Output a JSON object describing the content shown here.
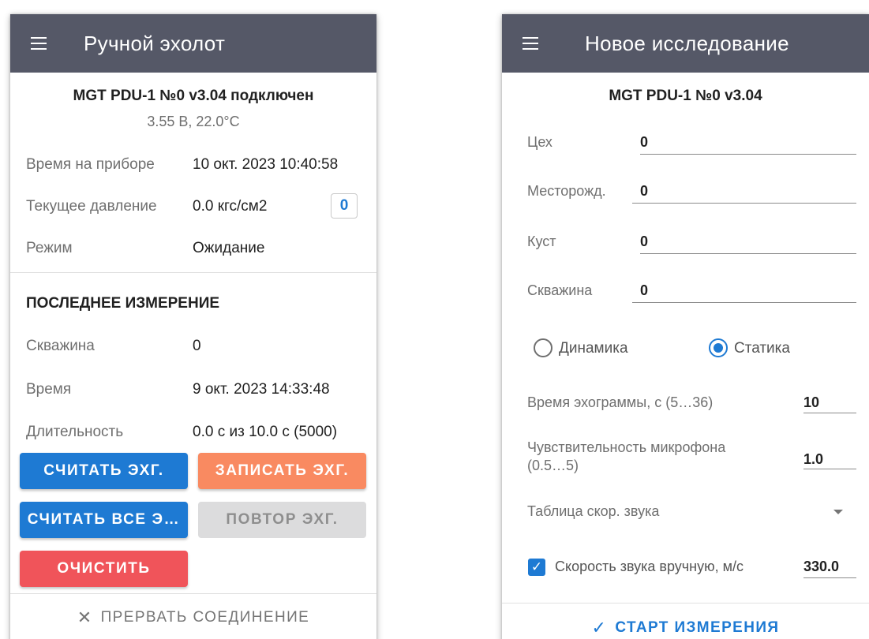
{
  "left_screen": {
    "appbar": {
      "menu_icon": "hamburger-menu-icon",
      "title": "Ручной эхолот"
    },
    "device": {
      "title": "MGT PDU-1 №0 v3.04 подключен",
      "status": "3.55 В, 22.0°C"
    },
    "info_rows": [
      {
        "label": "Время на приборе",
        "value": "10 окт. 2023 10:40:58"
      },
      {
        "label": "Текущее давление",
        "value": "0.0 кгс/см2",
        "chip": "0"
      },
      {
        "label": "Режим",
        "value": "Ожидание"
      }
    ],
    "last_measurement": {
      "heading": "ПОСЛЕДНЕЕ ИЗМЕРЕНИЕ",
      "rows": [
        {
          "label": "Скважина",
          "value": "0"
        },
        {
          "label": "Время",
          "value": "9 окт. 2023 14:33:48"
        },
        {
          "label": "Длительность",
          "value": "0.0 с из 10.0 с (5000)"
        }
      ]
    },
    "buttons": {
      "read_ehg": "СЧИТАТЬ ЭХГ.",
      "write_ehg": "ЗАПИСАТЬ ЭХГ.",
      "read_all": "СЧИТАТЬ ВСЕ Э…",
      "repeat_ehg": "ПОВТОР ЭХГ.",
      "clear": "ОЧИСТИТЬ"
    },
    "disconnect": {
      "icon": "close-icon",
      "label": "ПРЕРВАТЬ СОЕДИНЕНИЕ"
    }
  },
  "right_screen": {
    "appbar": {
      "menu_icon": "hamburger-menu-icon",
      "title": "Новое исследование"
    },
    "device_title": "MGT PDU-1 №0 v3.04",
    "fields": [
      {
        "label": "Цех",
        "value": "0"
      },
      {
        "label": "Месторожд.",
        "value": "0"
      },
      {
        "label": "Куст",
        "value": "0"
      },
      {
        "label": "Скважина",
        "value": "0"
      }
    ],
    "mode": {
      "options": [
        "Динамика",
        "Статика"
      ],
      "selected": "Статика"
    },
    "echogram_time": {
      "label": "Время эхограммы, с (5…36)",
      "value": "10"
    },
    "mic_sensitivity": {
      "label_line1": "Чувствительность микрофона",
      "label_line2": "(0.5…5)",
      "value": "1.0"
    },
    "sound_table": {
      "label": "Таблица скор. звука",
      "icon": "dropdown-arrow-icon"
    },
    "manual_speed": {
      "checked": true,
      "label": "Скорость звука вручную, м/с",
      "value": "330.0"
    },
    "start": {
      "icon": "check-icon",
      "label": "СТАРТ ИЗМЕРЕНИЯ"
    }
  },
  "colors": {
    "appbar": "#555867",
    "primary_blue": "#1e7ad3",
    "orange": "#f98a61",
    "red": "#f0545a",
    "disabled": "#dcdcdd"
  }
}
